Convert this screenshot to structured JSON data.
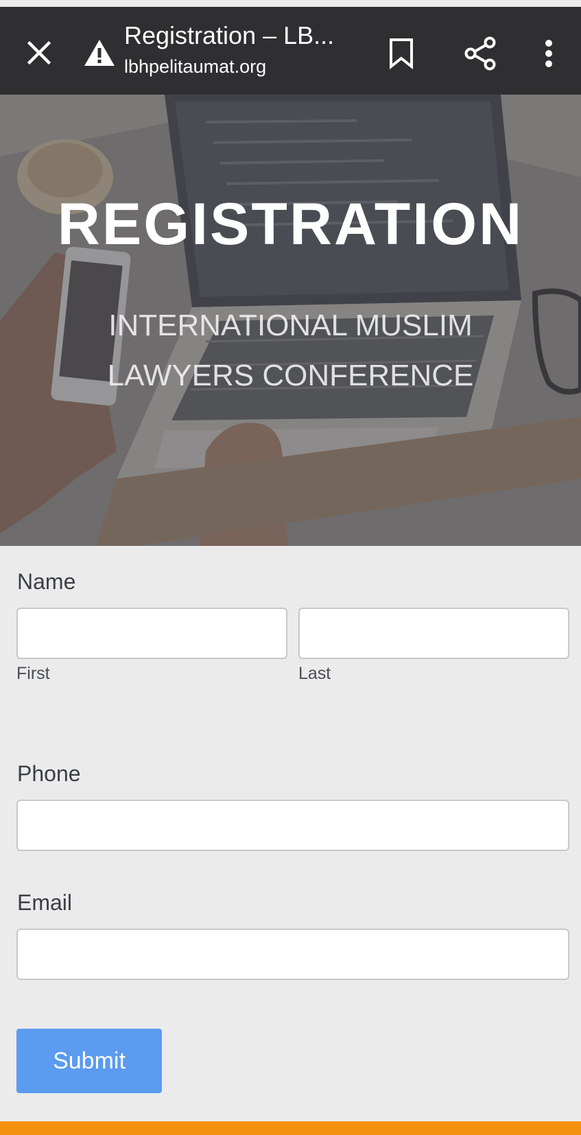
{
  "browser": {
    "title": "Registration – LB...",
    "url": "lbhpelitaumat.org",
    "icons": [
      "close-icon",
      "warning-icon",
      "bookmark-icon",
      "share-icon",
      "more-vert-icon"
    ]
  },
  "hero": {
    "title": "REGISTRATION",
    "subtitle": "INTERNATIONAL MUSLIM LAWYERS CONFERENCE"
  },
  "form": {
    "name_label": "Name",
    "first_label": "First",
    "last_label": "Last",
    "first_value": "",
    "last_value": "",
    "phone_label": "Phone",
    "phone_value": "",
    "email_label": "Email",
    "email_value": "",
    "submit_label": "Submit"
  },
  "colors": {
    "toolbar": "#2f2f31",
    "page_bg": "#ebebeb",
    "submit": "#5b9bf0",
    "bottom_accent": "#f4920f"
  }
}
